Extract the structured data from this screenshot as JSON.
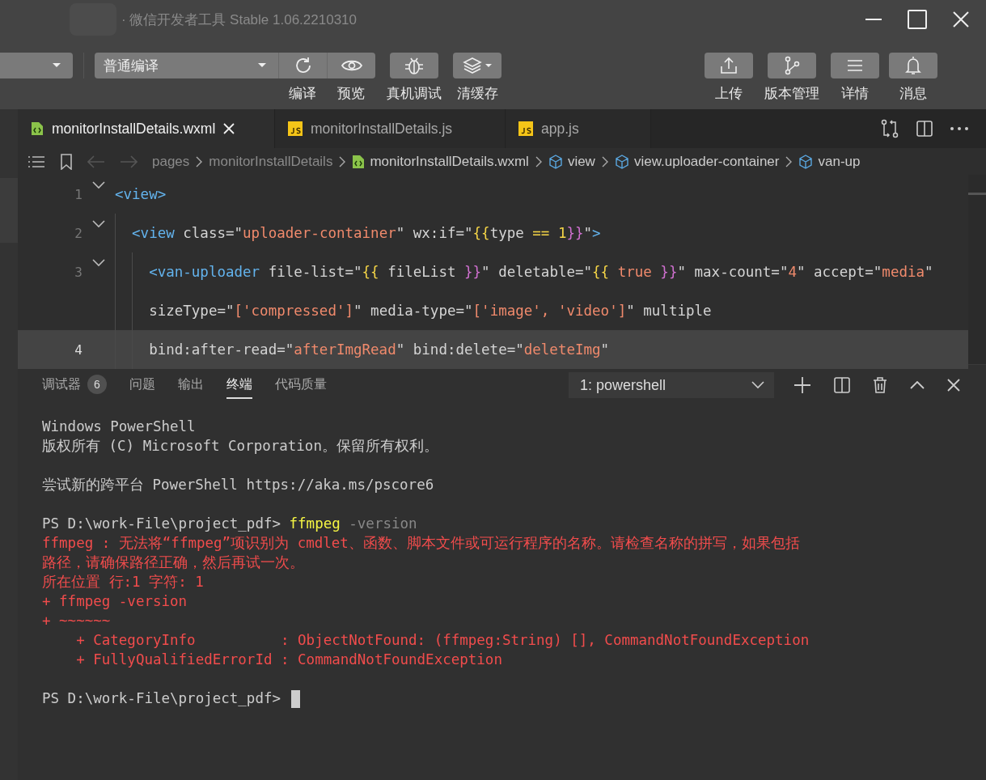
{
  "window": {
    "title": "· 微信开发者工具 Stable 1.06.2210310"
  },
  "toolbar": {
    "compile_mode": "普通编译",
    "left_tools": [
      {
        "kind": "compile",
        "label": "编译"
      },
      {
        "kind": "preview",
        "label": "预览"
      },
      {
        "kind": "debug",
        "label": "真机调试"
      },
      {
        "kind": "cache",
        "label": "清缓存"
      }
    ],
    "right_tools": [
      {
        "kind": "upload",
        "label": "上传"
      },
      {
        "kind": "version",
        "label": "版本管理"
      },
      {
        "kind": "details",
        "label": "详情"
      },
      {
        "kind": "messages",
        "label": "消息"
      }
    ]
  },
  "editor_tabs": [
    {
      "label": "monitorInstallDetails.wxml",
      "kind": "wxml",
      "selected": true
    },
    {
      "label": "monitorInstallDetails.js",
      "kind": "js",
      "selected": false
    },
    {
      "label": "app.js",
      "kind": "js",
      "selected": false
    }
  ],
  "breadcrumb": [
    {
      "kind": "folder",
      "label": "pages"
    },
    {
      "kind": "folder",
      "label": "monitorInstallDetails"
    },
    {
      "kind": "wxml",
      "label": "monitorInstallDetails.wxml"
    },
    {
      "kind": "element",
      "label": "view"
    },
    {
      "kind": "element",
      "label": "view.uploader-container"
    },
    {
      "kind": "element",
      "label": "van-up"
    }
  ],
  "code": [
    {
      "number": "1",
      "foldable": true,
      "current": false,
      "tokens": [
        {
          "kind": "tag",
          "text": "<view>"
        }
      ]
    },
    {
      "number": "2",
      "foldable": true,
      "current": false,
      "tokens": [
        {
          "kind": "tag",
          "text": "  <view"
        },
        {
          "kind": "attr",
          "text": " class"
        },
        {
          "kind": "punct",
          "text": "=\""
        },
        {
          "kind": "str",
          "text": "uploader-container"
        },
        {
          "kind": "punct",
          "text": "\""
        },
        {
          "kind": "attr",
          "text": " wx:if"
        },
        {
          "kind": "punct",
          "text": "=\""
        },
        {
          "kind": "lbrace",
          "text": "{{"
        },
        {
          "kind": "attr",
          "text": "type "
        },
        {
          "kind": "op",
          "text": "=="
        },
        {
          "kind": "op",
          "text": " 1"
        },
        {
          "kind": "rbrace",
          "text": "}}"
        },
        {
          "kind": "punct",
          "text": "\""
        },
        {
          "kind": "tag",
          "text": ">"
        }
      ]
    },
    {
      "number": "3",
      "foldable": true,
      "current": false,
      "tokens": [
        {
          "kind": "tag",
          "text": "    <van-uploader"
        },
        {
          "kind": "attr",
          "text": " file-list"
        },
        {
          "kind": "punct",
          "text": "=\""
        },
        {
          "kind": "lbrace",
          "text": "{{"
        },
        {
          "kind": "attr",
          "text": " fileList "
        },
        {
          "kind": "rbrace",
          "text": "}}"
        },
        {
          "kind": "punct",
          "text": "\""
        },
        {
          "kind": "attr",
          "text": " deletable"
        },
        {
          "kind": "punct",
          "text": "=\""
        },
        {
          "kind": "lbrace",
          "text": "{{"
        },
        {
          "kind": "str",
          "text": " true "
        },
        {
          "kind": "rbrace",
          "text": "}}"
        },
        {
          "kind": "punct",
          "text": "\""
        },
        {
          "kind": "attr",
          "text": " max-count"
        },
        {
          "kind": "punct",
          "text": "=\""
        },
        {
          "kind": "str",
          "text": "4"
        },
        {
          "kind": "punct",
          "text": "\""
        },
        {
          "kind": "attr",
          "text": " accept"
        },
        {
          "kind": "punct",
          "text": "=\""
        },
        {
          "kind": "str",
          "text": "media"
        },
        {
          "kind": "punct",
          "text": "\""
        }
      ]
    },
    {
      "foldable": false,
      "current": false,
      "tokens": [
        {
          "kind": "attr",
          "text": "    sizeType"
        },
        {
          "kind": "punct",
          "text": "=\""
        },
        {
          "kind": "str",
          "text": "['compressed']"
        },
        {
          "kind": "punct",
          "text": "\""
        },
        {
          "kind": "attr",
          "text": " media-type"
        },
        {
          "kind": "punct",
          "text": "=\""
        },
        {
          "kind": "str",
          "text": "['image', 'video']"
        },
        {
          "kind": "punct",
          "text": "\""
        },
        {
          "kind": "attr",
          "text": " multiple"
        }
      ]
    },
    {
      "number": "4",
      "foldable": false,
      "current": true,
      "tokens": [
        {
          "kind": "attr",
          "text": "    bind:after-read"
        },
        {
          "kind": "punct",
          "text": "=\""
        },
        {
          "kind": "str",
          "text": "afterImgRead"
        },
        {
          "kind": "punct",
          "text": "\""
        },
        {
          "kind": "attr",
          "text": " bind:delete"
        },
        {
          "kind": "punct",
          "text": "=\""
        },
        {
          "kind": "str",
          "text": "deleteImg"
        },
        {
          "kind": "punct",
          "text": "\""
        }
      ]
    }
  ],
  "panel_tabs": [
    {
      "label": "调试器",
      "badge": "6",
      "selected": false
    },
    {
      "label": "问题",
      "selected": false
    },
    {
      "label": "输出",
      "selected": false
    },
    {
      "label": "终端",
      "selected": true
    },
    {
      "label": "代码质量",
      "selected": false
    }
  ],
  "terminal_select": "1: powershell",
  "terminal": [
    {
      "lines": [
        {
          "kind": "output",
          "text": "Windows PowerShell"
        },
        {
          "kind": "output",
          "text": "版权所有 (C) Microsoft Corporation。保留所有权利。"
        }
      ]
    },
    {
      "lines": [
        {
          "kind": "output",
          "text": "尝试新的跨平台 PowerShell https://aka.ms/pscore6"
        }
      ]
    },
    {
      "lines": [
        {
          "kind": "prompt",
          "text": "PS D:\\work-File\\project_pdf>",
          "command": "ffmpeg",
          "args": "-version"
        },
        {
          "kind": "error",
          "text": "ffmpeg : 无法将“ffmpeg”项识别为 cmdlet、函数、脚本文件或可运行程序的名称。请检查名称的拼写，如果包括"
        },
        {
          "kind": "error",
          "text": "路径，请确保路径正确，然后再试一次。"
        },
        {
          "kind": "error",
          "text": "所在位置 行:1 字符: 1"
        },
        {
          "kind": "error",
          "text": "+ ffmpeg -version"
        },
        {
          "kind": "error",
          "text": "+ ~~~~~~"
        },
        {
          "kind": "error",
          "text": "    + CategoryInfo          : ObjectNotFound: (ffmpeg:String) [], CommandNotFoundException"
        },
        {
          "kind": "error",
          "text": "    + FullyQualifiedErrorId : CommandNotFoundException"
        }
      ]
    },
    {
      "lines": [
        {
          "kind": "prompt",
          "text": "PS D:\\work-File\\project_pdf>",
          "cursor": true
        }
      ]
    }
  ]
}
